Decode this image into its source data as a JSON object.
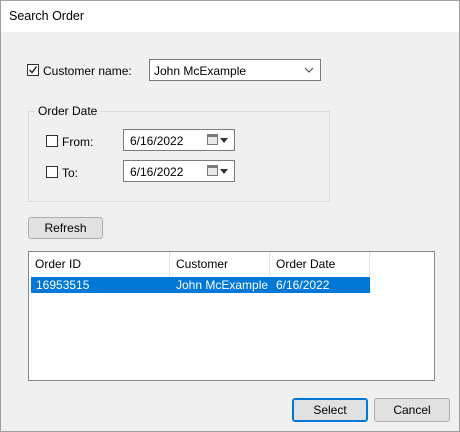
{
  "window": {
    "title": "Search Order"
  },
  "customer": {
    "checkbox_label": "Customer name:",
    "checked": true,
    "selected_value": "John McExample"
  },
  "order_date": {
    "group_title": "Order Date",
    "from": {
      "label": "From:",
      "checked": false,
      "date": "6/16/2022"
    },
    "to": {
      "label": "To:",
      "checked": false,
      "date": "6/16/2022"
    }
  },
  "refresh_label": "Refresh",
  "results": {
    "columns": [
      "Order ID",
      "Customer",
      "Order Date"
    ],
    "rows": [
      {
        "order_id": "16953515",
        "customer": "John McExample",
        "order_date": "6/16/2022",
        "selected": true
      }
    ]
  },
  "buttons": {
    "select_label": "Select",
    "cancel_label": "Cancel"
  },
  "colors": {
    "selection": "#0078d7",
    "dialog_bg": "#f0f0f0"
  }
}
